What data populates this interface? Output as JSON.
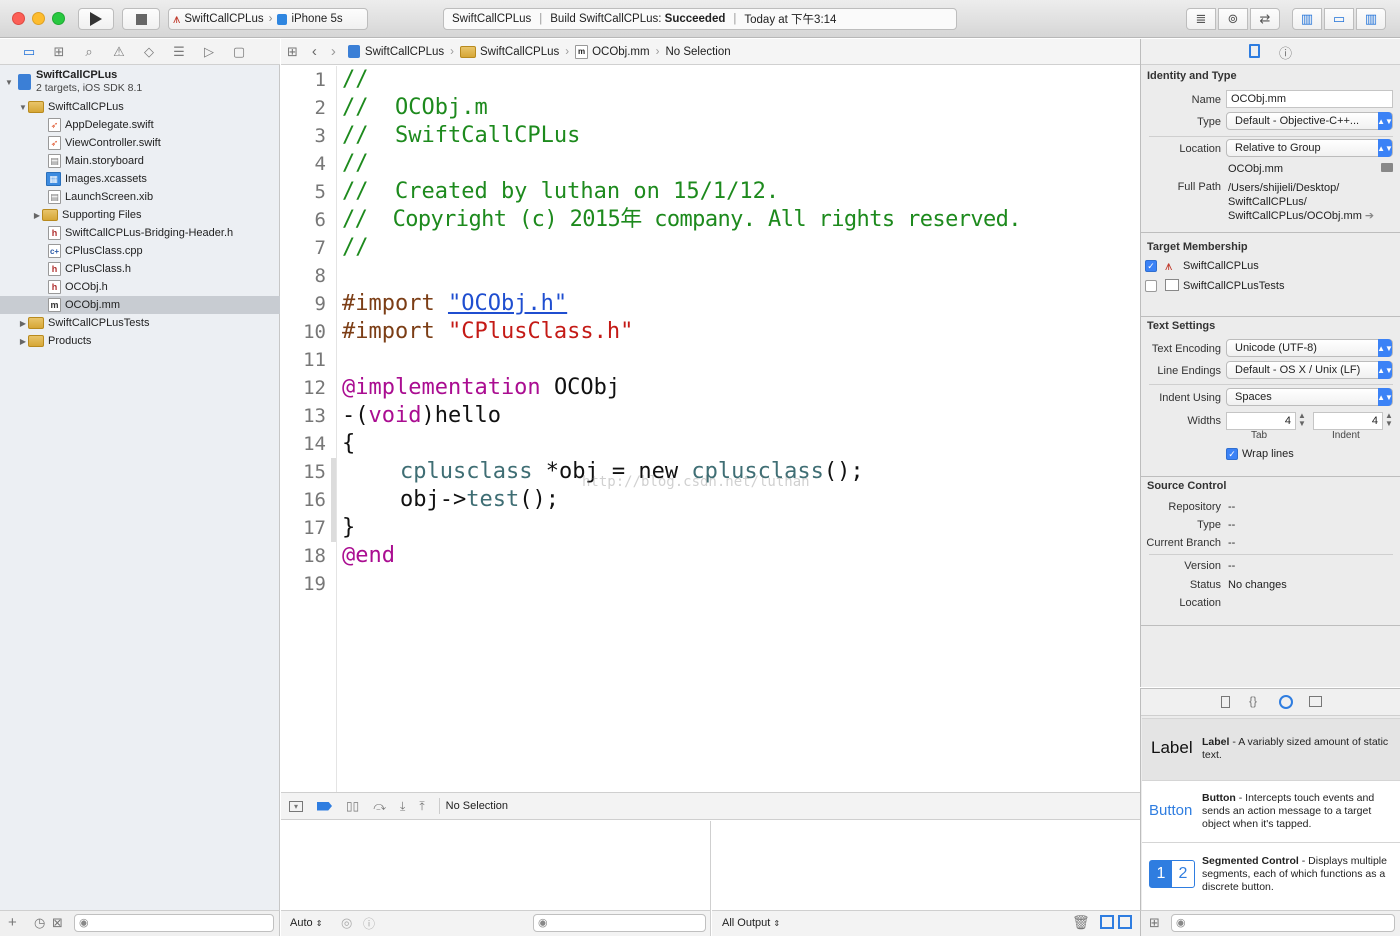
{
  "toolbar": {
    "scheme_name": "SwiftCallCPLus",
    "device_name": "iPhone 5s",
    "status_project": "SwiftCallCPLus",
    "status_build_prefix": "Build SwiftCallCPLus: ",
    "status_build_result": "Succeeded",
    "status_time": "Today at 下午3:14"
  },
  "navigator": {
    "project": {
      "name": "SwiftCallCPLus",
      "subtitle": "2 targets, iOS SDK 8.1"
    },
    "items": [
      {
        "label": "SwiftCallCPLus",
        "kind": "folder"
      },
      {
        "label": "AppDelegate.swift",
        "kind": "swift"
      },
      {
        "label": "ViewController.swift",
        "kind": "swift"
      },
      {
        "label": "Main.storyboard",
        "kind": "storyboard"
      },
      {
        "label": "Images.xcassets",
        "kind": "assets"
      },
      {
        "label": "LaunchScreen.xib",
        "kind": "xib"
      },
      {
        "label": "Supporting Files",
        "kind": "folder"
      },
      {
        "label": "SwiftCallCPLus-Bridging-Header.h",
        "kind": "h"
      },
      {
        "label": "CPlusClass.cpp",
        "kind": "cpp"
      },
      {
        "label": "CPlusClass.h",
        "kind": "h"
      },
      {
        "label": "OCObj.h",
        "kind": "h"
      },
      {
        "label": "OCObj.mm",
        "kind": "m"
      },
      {
        "label": "SwiftCallCPLusTests",
        "kind": "folder"
      },
      {
        "label": "Products",
        "kind": "folder"
      }
    ]
  },
  "jumpbar": {
    "crumbs": [
      "SwiftCallCPLus",
      "SwiftCallCPLus",
      "OCObj.mm",
      "No Selection"
    ]
  },
  "editor": {
    "line_numbers": [
      "1",
      "2",
      "3",
      "4",
      "5",
      "6",
      "7",
      "8",
      "9",
      "10",
      "11",
      "12",
      "13",
      "14",
      "15",
      "16",
      "17",
      "18",
      "19"
    ],
    "lines": {
      "l1": "//",
      "l2": "//  OCObj.m",
      "l3": "//  SwiftCallCPLus",
      "l4": "//",
      "l5": "//  Created by luthan on 15/1/12.",
      "l6": "//  Copyright (c) 2015年 company. All rights reserved.",
      "l7": "//",
      "l9_directive": "#import",
      "l9_string": "\"OCObj.h\"",
      "l10_directive": "#import",
      "l10_string": "\"CPlusClass.h\"",
      "l12_keyword": "@implementation",
      "l12_name": "OCObj",
      "l13_a": "-(",
      "l13_type": "void",
      "l13_b": ")hello",
      "l14": "{",
      "l15_type": "cplusclass",
      "l15_a": " *obj = ",
      "l15_kw": "new",
      "l15_fn": "cplusclass",
      "l15_b": "();",
      "l16_a": "obj->",
      "l16_fn": "test",
      "l16_b": "();",
      "l17": "}",
      "l18": "@end"
    },
    "watermark": "http://blog.csdn.net/luthan"
  },
  "debug": {
    "status": "No Selection",
    "auto_label": "Auto",
    "output_label": "All Output"
  },
  "inspector": {
    "identity_title": "Identity and Type",
    "name_label": "Name",
    "name_value": "OCObj.mm",
    "type_label": "Type",
    "type_value": "Default - Objective-C++...",
    "location_label": "Location",
    "location_value": "Relative to Group",
    "location_file": "OCObj.mm",
    "fullpath_label": "Full Path",
    "fullpath_lines": [
      "/Users/shijieli/Desktop/",
      "SwiftCallCPLus/",
      "SwiftCallCPLus/OCObj.mm"
    ],
    "target_title": "Target Membership",
    "targets": [
      {
        "name": "SwiftCallCPLus",
        "checked": true
      },
      {
        "name": "SwiftCallCPLusTests",
        "checked": false
      }
    ],
    "text_title": "Text Settings",
    "encoding_label": "Text Encoding",
    "encoding_value": "Unicode (UTF-8)",
    "endings_label": "Line Endings",
    "endings_value": "Default - OS X / Unix (LF)",
    "indent_label": "Indent Using",
    "indent_value": "Spaces",
    "widths_label": "Widths",
    "tab_value": "4",
    "indent_width_value": "4",
    "tab_caption": "Tab",
    "indent_caption": "Indent",
    "wrap_label": "Wrap lines",
    "source_title": "Source Control",
    "repo_label": "Repository",
    "repo_value": "--",
    "sc_type_label": "Type",
    "sc_type_value": "--",
    "branch_label": "Current Branch",
    "branch_value": "--",
    "version_label": "Version",
    "version_value": "--",
    "status_label": "Status",
    "status_value": "No changes",
    "sc_location_label": "Location"
  },
  "library": {
    "items": [
      {
        "preview": "Label",
        "title": "Label",
        "desc": " - A variably sized amount of static text."
      },
      {
        "preview": "Button",
        "title": "Button",
        "desc": " - Intercepts touch events and sends an action message to a target object when it's tapped."
      },
      {
        "preview_a": "1",
        "preview_b": "2",
        "title": "Segmented Control",
        "desc": " - Displays multiple segments, each of which functions as a discrete button."
      }
    ]
  },
  "colors": {
    "accent": "#3b82f6",
    "comment": "#1d8a1d",
    "keyword": "#aa0d91",
    "string": "#c41a16",
    "selection": "#c8ccd2"
  }
}
